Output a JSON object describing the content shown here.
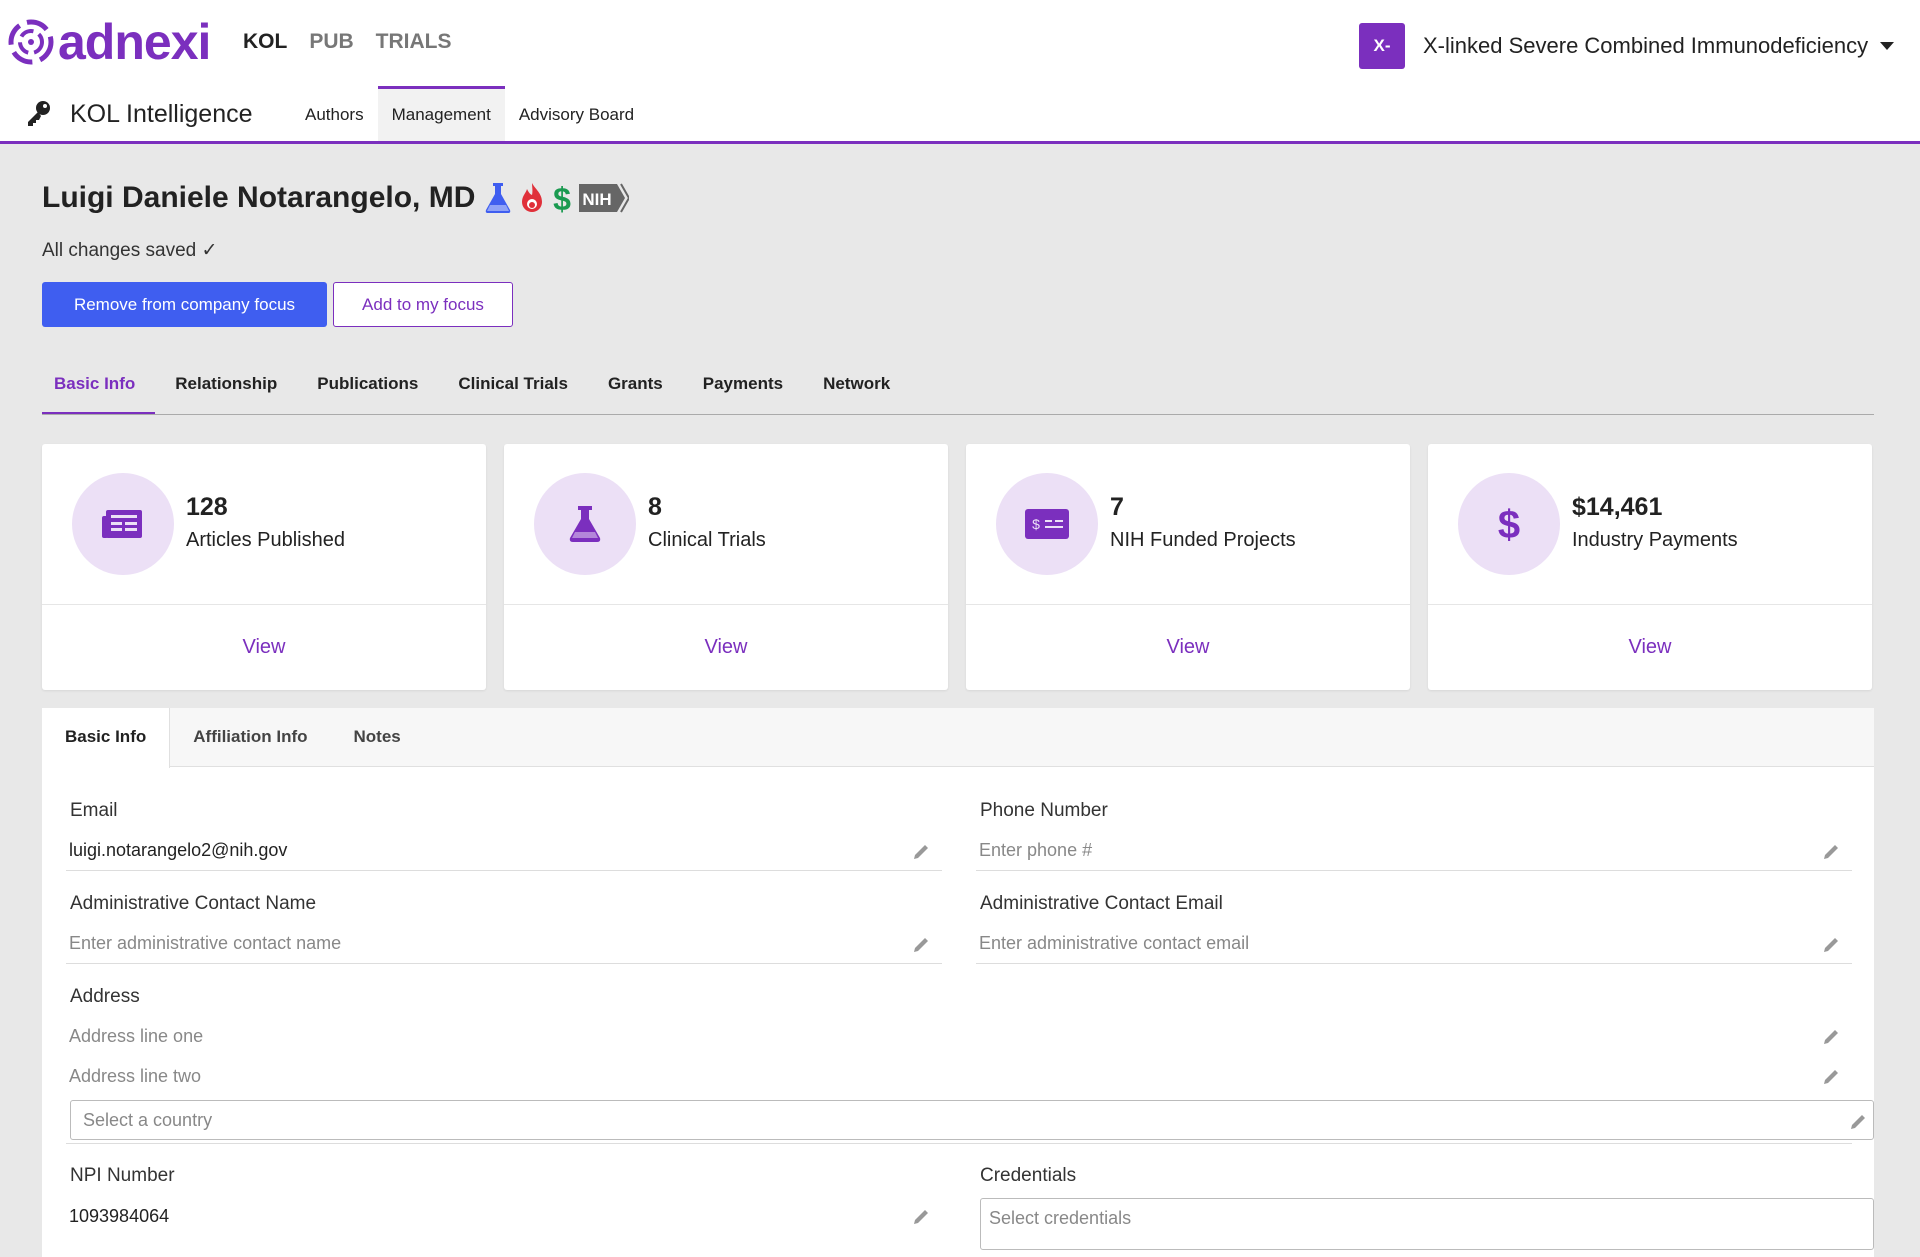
{
  "header": {
    "logo_text": "adnexi",
    "nav": [
      {
        "label": "KOL",
        "active": true
      },
      {
        "label": "PUB",
        "active": false
      },
      {
        "label": "TRIALS",
        "active": false
      }
    ],
    "disease": {
      "badge": "X-",
      "name": "X-linked Severe Combined Immunodeficiency"
    }
  },
  "subheader": {
    "title": "KOL Intelligence",
    "tabs": [
      {
        "label": "Authors",
        "active": false
      },
      {
        "label": "Management",
        "active": true
      },
      {
        "label": "Advisory Board",
        "active": false
      }
    ]
  },
  "profile": {
    "name": "Luigi Daniele Notarangelo, MD",
    "nih_badge": "NIH",
    "status": "All changes saved ✓",
    "remove_button": "Remove from company focus",
    "add_button": "Add to my focus"
  },
  "section_tabs": [
    "Basic Info",
    "Relationship",
    "Publications",
    "Clinical Trials",
    "Grants",
    "Payments",
    "Network"
  ],
  "stats": [
    {
      "value": "128",
      "label": "Articles Published",
      "view": "View",
      "icon": "newspaper-icon"
    },
    {
      "value": "8",
      "label": "Clinical Trials",
      "view": "View",
      "icon": "flask-icon"
    },
    {
      "value": "7",
      "label": "NIH Funded Projects",
      "view": "View",
      "icon": "money-check-icon"
    },
    {
      "value": "$14,461",
      "label": "Industry Payments",
      "view": "View",
      "icon": "dollar-icon"
    }
  ],
  "form": {
    "tabs": [
      "Basic Info",
      "Affiliation Info",
      "Notes"
    ],
    "email": {
      "label": "Email",
      "value": "luigi.notarangelo2@nih.gov"
    },
    "phone": {
      "label": "Phone Number",
      "placeholder": "Enter phone #"
    },
    "admin_name": {
      "label": "Administrative Contact Name",
      "placeholder": "Enter administrative contact name"
    },
    "admin_email": {
      "label": "Administrative Contact Email",
      "placeholder": "Enter administrative contact email"
    },
    "address": {
      "label": "Address",
      "line1_placeholder": "Address line one",
      "line2_placeholder": "Address line two",
      "country_placeholder": "Select a country"
    },
    "npi": {
      "label": "NPI Number",
      "value": "1093984064"
    },
    "credentials": {
      "label": "Credentials",
      "placeholder": "Select credentials"
    }
  },
  "colors": {
    "brand": "#7b2fbe",
    "primary_button": "#3f5ef0"
  }
}
